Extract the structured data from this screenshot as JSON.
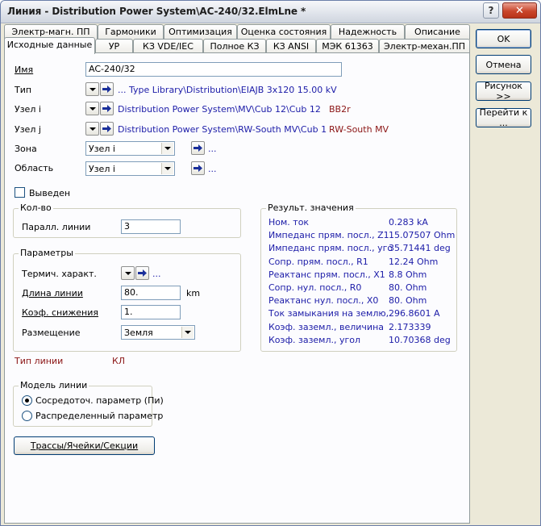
{
  "window": {
    "title": "Линия - Distribution Power System\\AC-240/32.ElmLne *",
    "help_label": "?",
    "close_label": "✕"
  },
  "tabs_row1": [
    "Электр-магн. ПП",
    "Гармоники",
    "Оптимизация",
    "Оценка состояния",
    "Надежность",
    "Описание"
  ],
  "tabs_row2": [
    "Исходные данные",
    "УР",
    "КЗ VDE/IEC",
    "Полное КЗ",
    "КЗ ANSI",
    "МЭК 61363",
    "Электр-механ.ПП"
  ],
  "form": {
    "name_label": "Имя",
    "name_value": "AC-240/32",
    "type_label": "Тип",
    "type_value": "... Type Library\\Distribution\\EIAJB 3x120  15.00 kV",
    "node_i_label": "Узел i",
    "node_i_value": "Distribution Power System\\MV\\Cub 12\\Cub 12",
    "node_i_bus": "BB2r",
    "node_j_label": "Узел j",
    "node_j_value": "Distribution Power System\\RW-South MV\\Cub 1",
    "node_j_bus": "RW-South MV",
    "zone_label": "Зона",
    "zone_value": "Узел i",
    "area_label": "Область",
    "area_value": "Узел i",
    "dots": "...",
    "out_of_service_label": "Выведен"
  },
  "count_group": {
    "title": "Кол-во",
    "parallel_label": "Паралл. линии",
    "parallel_value": "3"
  },
  "params_group": {
    "title": "Параметры",
    "thermal_label": "Термич. характ.",
    "length_label": "Длина линии",
    "length_value": "80.",
    "length_unit": "km",
    "derating_label": "Коэф. снижения",
    "derating_value": "1.",
    "placement_label": "Размещение",
    "placement_value": "Земля"
  },
  "line_type": {
    "label": "Тип линии",
    "value": "КЛ"
  },
  "results_group": {
    "title": "Результ. значения",
    "rows": [
      {
        "label": "Ном. ток",
        "value": "0.283 kA"
      },
      {
        "label": "Импеданс прям. посл., Z1",
        "value": "15.07507 Ohm"
      },
      {
        "label": "Импеданс прям. посл., угол",
        "value": "35.71441 deg"
      },
      {
        "label": "Сопр. прям. посл., R1",
        "value": "12.24 Ohm"
      },
      {
        "label": "Реактанс прям. посл., X1",
        "value": "8.8 Ohm"
      },
      {
        "label": "Сопр. нул. посл., R0",
        "value": "80. Ohm"
      },
      {
        "label": "Реактанс нул. посл., X0",
        "value": "80. Ohm"
      },
      {
        "label": "Ток замыкания на землю, Ice",
        "value": "296.8601 A"
      },
      {
        "label": "Коэф. заземл., величина",
        "value": "2.173339"
      },
      {
        "label": "Коэф. заземл., угол",
        "value": "10.70368 deg"
      }
    ]
  },
  "model_group": {
    "title": "Модель линии",
    "option1": "Сосредоточ. параметр (Пи)",
    "option2": "Распределенный параметр"
  },
  "routes_button": "Трассы/Ячейки/Секции",
  "side_buttons": {
    "ok": "OK",
    "cancel": "Отмена",
    "figure": "Рисунок >>",
    "goto": "Перейти к ..."
  }
}
